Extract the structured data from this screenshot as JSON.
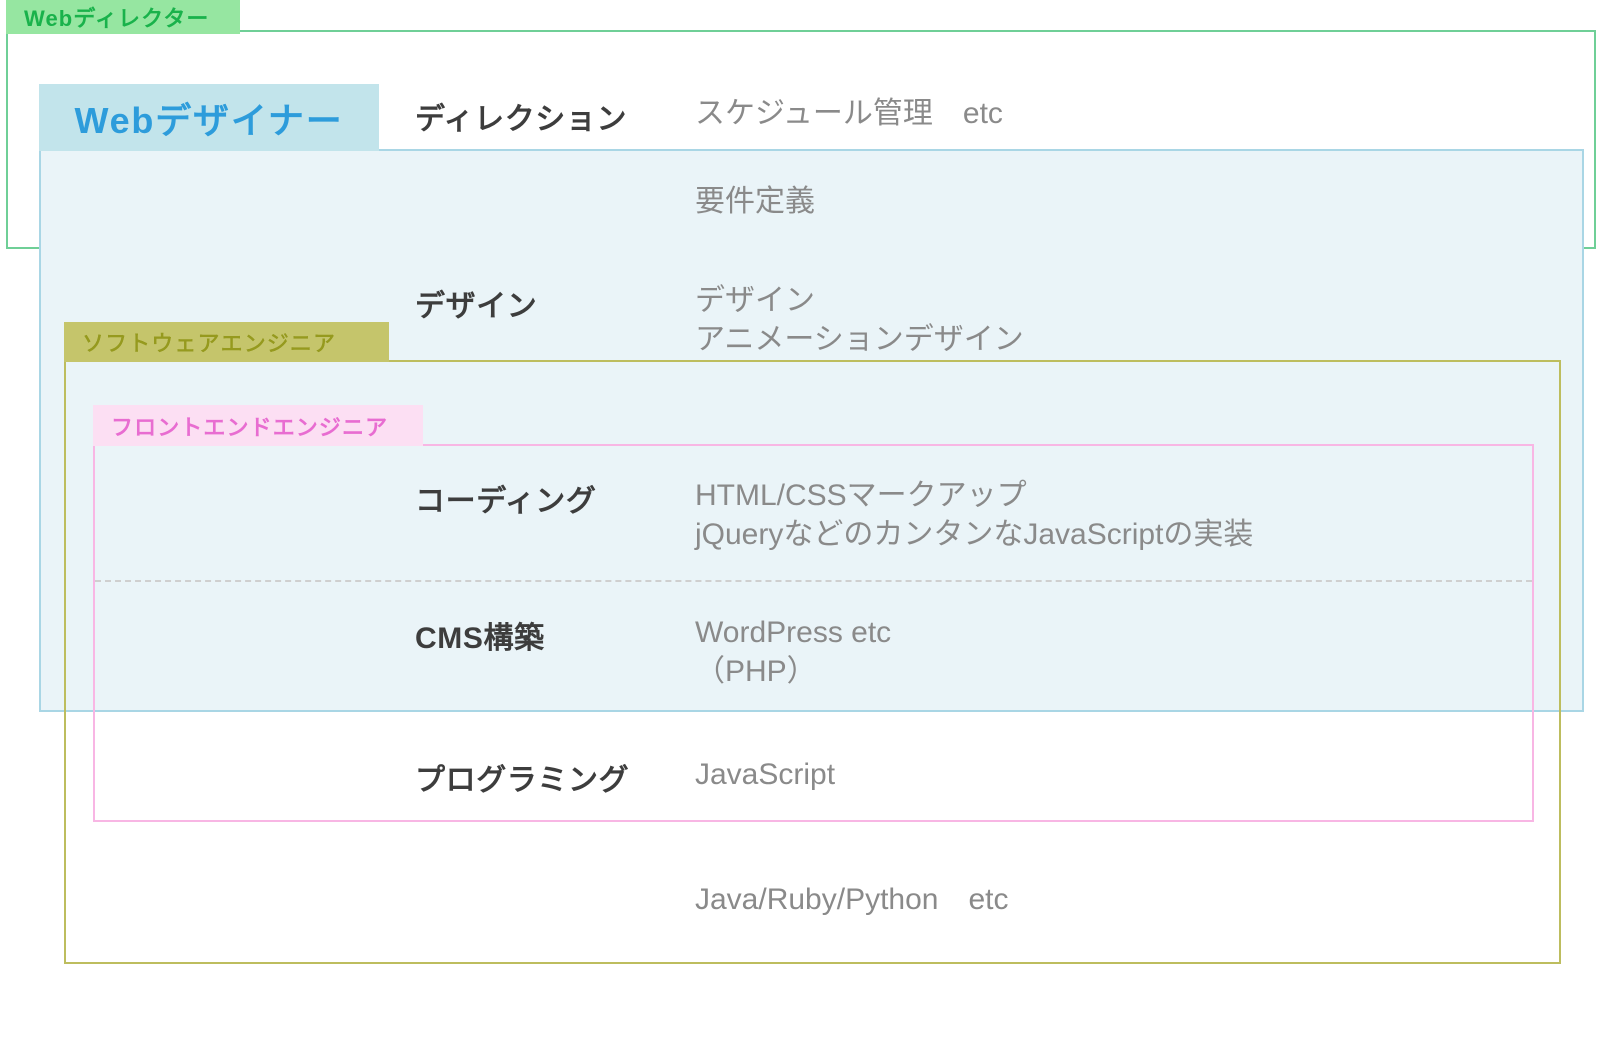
{
  "groups": {
    "director": {
      "label": "Webディレクター"
    },
    "designer": {
      "label": "Webデザイナー"
    },
    "software": {
      "label": "ソフトウェアエンジニア"
    },
    "frontend": {
      "label": "フロントエンドエンジニア"
    }
  },
  "rows": {
    "direction": {
      "category": "ディレクション",
      "desc": "スケジュール管理　etc"
    },
    "requirements": {
      "category": "",
      "desc": "要件定義"
    },
    "design": {
      "category": "デザイン",
      "desc": "デザイン\nアニメーションデザイン"
    },
    "coding": {
      "category": "コーディング",
      "desc": "HTML/CSSマークアップ\njQueryなどのカンタンなJavaScriptの実装"
    },
    "cms": {
      "category": "CMS構築",
      "desc": "WordPress etc\n（PHP）"
    },
    "programming": {
      "category": "プログラミング",
      "desc": "JavaScript"
    },
    "backend": {
      "category": "",
      "desc": "Java/Ruby/Python　etc"
    }
  }
}
